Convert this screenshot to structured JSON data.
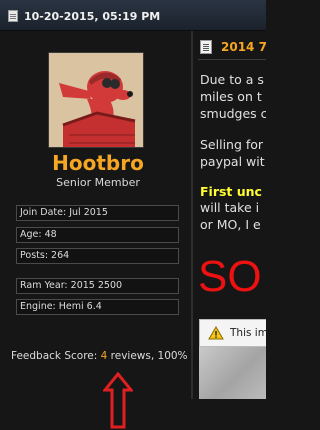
{
  "post_header": {
    "date": "10-20-2015, 05:19 PM"
  },
  "user": {
    "username": "Hootbro",
    "title": "Senior Member",
    "info": [
      {
        "text": "Join Date: Jul 2015"
      },
      {
        "text": "Age: 48"
      },
      {
        "text": "Posts: 264"
      },
      {
        "text": "Ram Year: 2015 2500"
      },
      {
        "text": "Engine: Hemi 6.4"
      }
    ],
    "feedback": {
      "label": "Feedback Score: ",
      "count": "4",
      "suffix": " reviews, 100%"
    }
  },
  "post": {
    "title": "2014 7'",
    "body_lines": [
      "Due to a s",
      "miles on t",
      "smudges c"
    ],
    "selling_lines": [
      "Selling for",
      "paypal wit"
    ],
    "first_highlight": "First unc",
    "first_lines": [
      "will take i",
      "or MO, I e"
    ],
    "big_text": "SO",
    "warning_text": "This im"
  },
  "colors": {
    "username": "#f5a623",
    "big_text": "#ee1111",
    "highlight": "#ffff33",
    "arrow": "#e02020"
  }
}
